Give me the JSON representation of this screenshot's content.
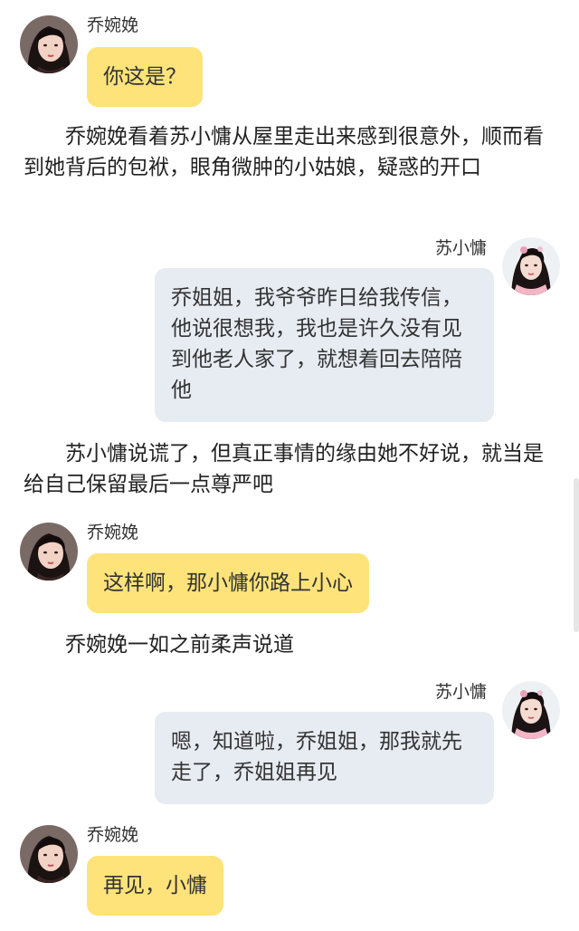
{
  "characters": {
    "qiao": {
      "name": "乔婉娩",
      "avatar_icon": "female-portrait-avatar-icon"
    },
    "su": {
      "name": "苏小慵",
      "avatar_icon": "female-costume-portrait-avatar-icon"
    }
  },
  "colors": {
    "left_bubble": "#fde37a",
    "right_bubble": "#e7ebf2",
    "text": "#222222"
  },
  "chat": [
    {
      "type": "message",
      "side": "left",
      "speaker": "乔婉娩",
      "text": "你这是？"
    },
    {
      "type": "narration",
      "text": "乔婉娩看着苏小慵从屋里走出来感到很意外，顺而看到她背后的包袱，眼角微肿的小姑娘，疑惑的开口"
    },
    {
      "type": "message",
      "side": "right",
      "speaker": "苏小慵",
      "text": "乔姐姐，我爷爷昨日给我传信，他说很想我，我也是许久没有见到他老人家了，就想着回去陪陪他"
    },
    {
      "type": "narration",
      "text": "苏小慵说谎了，但真正事情的缘由她不好说，就当是给自己保留最后一点尊严吧"
    },
    {
      "type": "message",
      "side": "left",
      "speaker": "乔婉娩",
      "text": "这样啊，那小慵你路上小心"
    },
    {
      "type": "narration",
      "text": "乔婉娩一如之前柔声说道"
    },
    {
      "type": "message",
      "side": "right",
      "speaker": "苏小慵",
      "text": "嗯，知道啦，乔姐姐，那我就先走了，乔姐姐再见"
    },
    {
      "type": "message",
      "side": "left",
      "speaker": "乔婉娩",
      "text": "再见，小慵"
    }
  ]
}
